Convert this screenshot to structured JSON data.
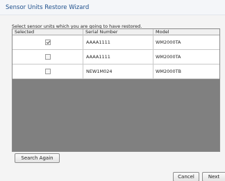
{
  "window": {
    "title": "Sensor Units Restore Wizard"
  },
  "instruction": "Select sensor units which you are going to have restored.",
  "grid": {
    "columns": [
      "Selected",
      "Serial Number",
      "Model"
    ],
    "rows": [
      {
        "selected": true,
        "serial": "AAAA1111",
        "model": "WM2000TA"
      },
      {
        "selected": false,
        "serial": "AAAA1111",
        "model": "WM2000TA"
      },
      {
        "selected": false,
        "serial": "NEW1M024",
        "model": "WM2000TB"
      }
    ]
  },
  "buttons": {
    "search_again": "Search Again",
    "cancel": "Cancel",
    "next": "Next"
  }
}
